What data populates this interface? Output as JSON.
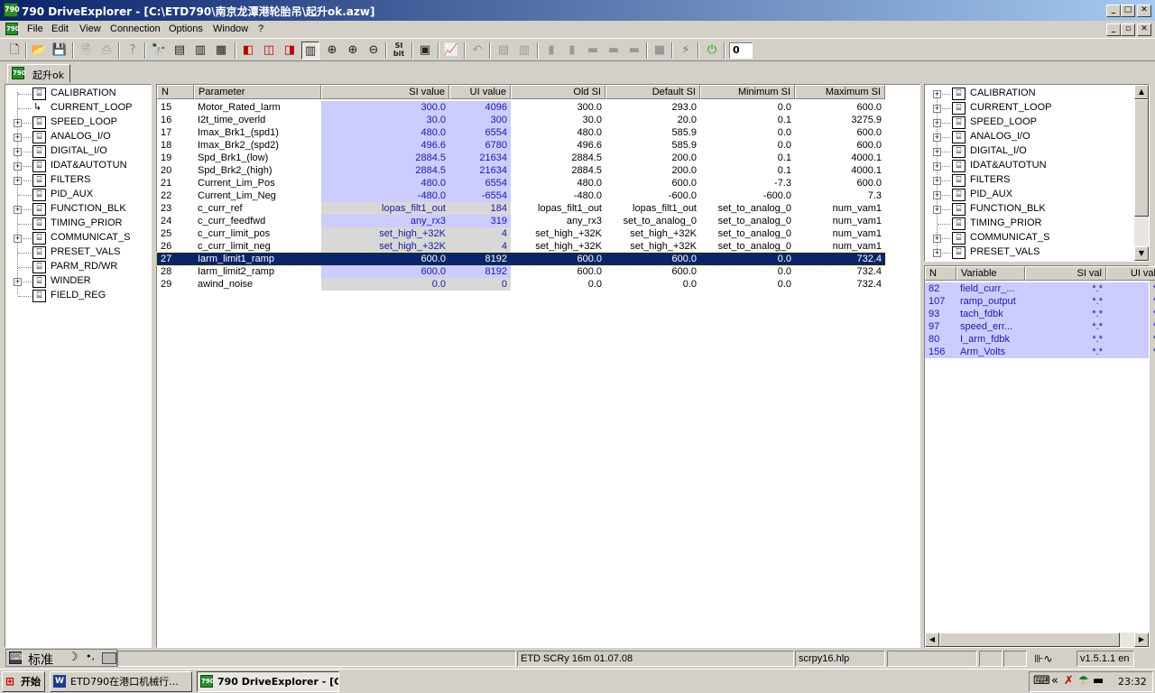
{
  "window": {
    "title": "790 DriveExplorer - [C:\\ETD790\\南京龙潭港轮胎吊\\起升ok.azw]",
    "app_icon": "790"
  },
  "menu": [
    "File",
    "Edit",
    "View",
    "Connection",
    "Options",
    "Window",
    "?"
  ],
  "toolbar": {
    "counter_value": "0"
  },
  "tab": {
    "label": "起升ok"
  },
  "left_tree": [
    {
      "label": "CALIBRATION",
      "expandable": false
    },
    {
      "label": "CURRENT_LOOP",
      "expandable": false,
      "arrow": true
    },
    {
      "label": "SPEED_LOOP",
      "expandable": true
    },
    {
      "label": "ANALOG_I/O",
      "expandable": true
    },
    {
      "label": "DIGITAL_I/O",
      "expandable": true
    },
    {
      "label": "IDAT&AUTOTUN",
      "expandable": true
    },
    {
      "label": "FILTERS",
      "expandable": true
    },
    {
      "label": "PID_AUX",
      "expandable": false
    },
    {
      "label": "FUNCTION_BLK",
      "expandable": true
    },
    {
      "label": "TIMING_PRIOR",
      "expandable": false
    },
    {
      "label": "COMMUNICAT_S",
      "expandable": true
    },
    {
      "label": "PRESET_VALS",
      "expandable": false
    },
    {
      "label": "PARM_RD/WR",
      "expandable": false
    },
    {
      "label": "WINDER",
      "expandable": true
    },
    {
      "label": "FIELD_REG",
      "expandable": false
    }
  ],
  "param_table": {
    "columns": [
      "N",
      "Parameter",
      "SI value",
      "UI value",
      "Old SI",
      "Default SI",
      "Minimum SI",
      "Maximum SI"
    ],
    "rows": [
      {
        "n": "15",
        "param": "Motor_Rated_Iarm",
        "si": "300.0",
        "ui": "4096",
        "old": "300.0",
        "def": "293.0",
        "min": "0.0",
        "max": "600.0",
        "hl": true
      },
      {
        "n": "16",
        "param": "I2t_time_overld",
        "si": "30.0",
        "ui": "300",
        "old": "30.0",
        "def": "20.0",
        "min": "0.1",
        "max": "3275.9",
        "hl": true
      },
      {
        "n": "17",
        "param": "Imax_Brk1_(spd1)",
        "si": "480.0",
        "ui": "6554",
        "old": "480.0",
        "def": "585.9",
        "min": "0.0",
        "max": "600.0",
        "hl": true
      },
      {
        "n": "18",
        "param": "Imax_Brk2_(spd2)",
        "si": "496.6",
        "ui": "6780",
        "old": "496.6",
        "def": "585.9",
        "min": "0.0",
        "max": "600.0",
        "hl": true
      },
      {
        "n": "19",
        "param": "Spd_Brk1_(low)",
        "si": "2884.5",
        "ui": "21634",
        "old": "2884.5",
        "def": "200.0",
        "min": "0.1",
        "max": "4000.1",
        "hl": true
      },
      {
        "n": "20",
        "param": "Spd_Brk2_(high)",
        "si": "2884.5",
        "ui": "21634",
        "old": "2884.5",
        "def": "200.0",
        "min": "0.1",
        "max": "4000.1",
        "hl": true
      },
      {
        "n": "21",
        "param": "Current_Lim_Pos",
        "si": "480.0",
        "ui": "6554",
        "old": "480.0",
        "def": "600.0",
        "min": "-7.3",
        "max": "600.0",
        "hl": true
      },
      {
        "n": "22",
        "param": "Current_Lim_Neg",
        "si": "-480.0",
        "ui": "-6554",
        "old": "-480.0",
        "def": "-600.0",
        "min": "-600.0",
        "max": "7.3",
        "hl": true
      },
      {
        "n": "23",
        "param": "c_curr_ref",
        "si": "lopas_filt1_out",
        "ui": "184",
        "old": "lopas_filt1_out",
        "def": "lopas_filt1_out",
        "min": "set_to_analog_0",
        "max": "num_vam1",
        "hl": false
      },
      {
        "n": "24",
        "param": "c_curr_feedfwd",
        "si": "any_rx3",
        "ui": "319",
        "old": "any_rx3",
        "def": "set_to_analog_0",
        "min": "set_to_analog_0",
        "max": "num_vam1",
        "hl": true
      },
      {
        "n": "25",
        "param": "c_curr_limit_pos",
        "si": "set_high_+32K",
        "ui": "4",
        "old": "set_high_+32K",
        "def": "set_high_+32K",
        "min": "set_to_analog_0",
        "max": "num_vam1",
        "hl": false
      },
      {
        "n": "26",
        "param": "c_curr_limit_neg",
        "si": "set_high_+32K",
        "ui": "4",
        "old": "set_high_+32K",
        "def": "set_high_+32K",
        "min": "set_to_analog_0",
        "max": "num_vam1",
        "hl": false
      },
      {
        "n": "27",
        "param": "Iarm_limit1_ramp",
        "si": "600.0",
        "ui": "8192",
        "old": "600.0",
        "def": "600.0",
        "min": "0.0",
        "max": "732.4",
        "hl": true,
        "selected": true
      },
      {
        "n": "28",
        "param": "Iarm_limit2_ramp",
        "si": "600.0",
        "ui": "8192",
        "old": "600.0",
        "def": "600.0",
        "min": "0.0",
        "max": "732.4",
        "hl": true
      },
      {
        "n": "29",
        "param": "awind_noise",
        "si": "0.0",
        "ui": "0",
        "old": "0.0",
        "def": "0.0",
        "min": "0.0",
        "max": "732.4",
        "hl": false
      }
    ]
  },
  "right_tree": [
    {
      "label": "CALIBRATION",
      "expandable": true
    },
    {
      "label": "CURRENT_LOOP",
      "expandable": true
    },
    {
      "label": "SPEED_LOOP",
      "expandable": true
    },
    {
      "label": "ANALOG_I/O",
      "expandable": true
    },
    {
      "label": "DIGITAL_I/O",
      "expandable": true
    },
    {
      "label": "IDAT&AUTOTUN",
      "expandable": true
    },
    {
      "label": "FILTERS",
      "expandable": true
    },
    {
      "label": "PID_AUX",
      "expandable": true
    },
    {
      "label": "FUNCTION_BLK",
      "expandable": true
    },
    {
      "label": "TIMING_PRIOR",
      "expandable": false
    },
    {
      "label": "COMMUNICAT_S",
      "expandable": true
    },
    {
      "label": "PRESET_VALS",
      "expandable": true
    }
  ],
  "var_table": {
    "columns": [
      "N",
      "Variable",
      "SI val",
      "UI val"
    ],
    "rows": [
      {
        "n": "82",
        "name": "field_curr_...",
        "si": "*.*",
        "ui": "*"
      },
      {
        "n": "107",
        "name": "ramp_output",
        "si": "*.*",
        "ui": "*"
      },
      {
        "n": "93",
        "name": "tach_fdbk",
        "si": "*.*",
        "ui": "*"
      },
      {
        "n": "97",
        "name": "speed_err...",
        "si": "*.*",
        "ui": "*"
      },
      {
        "n": "80",
        "name": "I_arm_fdbk",
        "si": "*.*",
        "ui": "*"
      },
      {
        "n": "156",
        "name": "Arm_Volts",
        "si": "*.*",
        "ui": "*"
      }
    ]
  },
  "statusbar": {
    "ime_label": "标准",
    "ime_moon": "☽",
    "ime_dots": "•,",
    "etd": "ETD SCRy 16m 01.07.08",
    "help": "scrpy16.hlp",
    "version": "v1.5.1.1 en"
  },
  "taskbar": {
    "start": "开始",
    "tasks": [
      "ETD790在港口机械行...",
      "790 DriveExplorer - [C:\\..."
    ],
    "clock": "23:32",
    "tray_chevron": "«"
  },
  "colors": {
    "title_start": "#0a246a",
    "title_end": "#a6caf0",
    "highlight_cell": "#ccccff",
    "selected_row": "#0a246a",
    "value_text": "#1a1aa6"
  }
}
